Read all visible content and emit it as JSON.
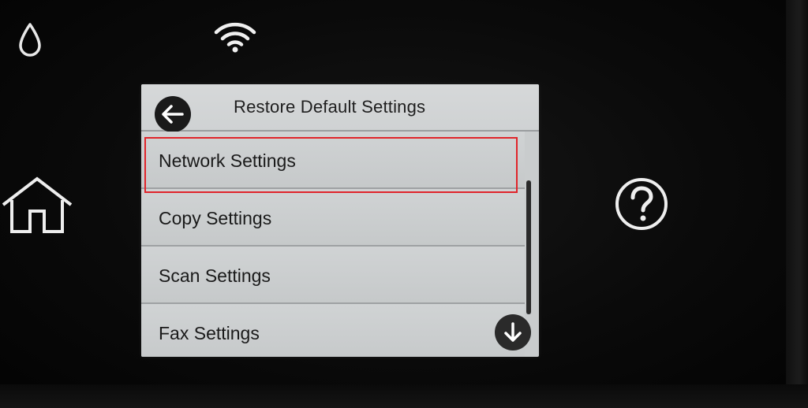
{
  "hardware": {
    "icons": {
      "ink": "ink-drop-icon",
      "wifi": "wifi-icon",
      "home": "home-icon",
      "help": "help-icon"
    }
  },
  "screen": {
    "title": "Restore Default Settings",
    "back_icon": "back-arrow-icon",
    "scroll_down_icon": "down-arrow-icon",
    "items": [
      {
        "label": "Network Settings",
        "highlighted": true
      },
      {
        "label": "Copy Settings",
        "highlighted": false
      },
      {
        "label": "Scan Settings",
        "highlighted": false
      },
      {
        "label": "Fax Settings",
        "highlighted": false
      }
    ],
    "highlight_color": "#e0242a"
  }
}
